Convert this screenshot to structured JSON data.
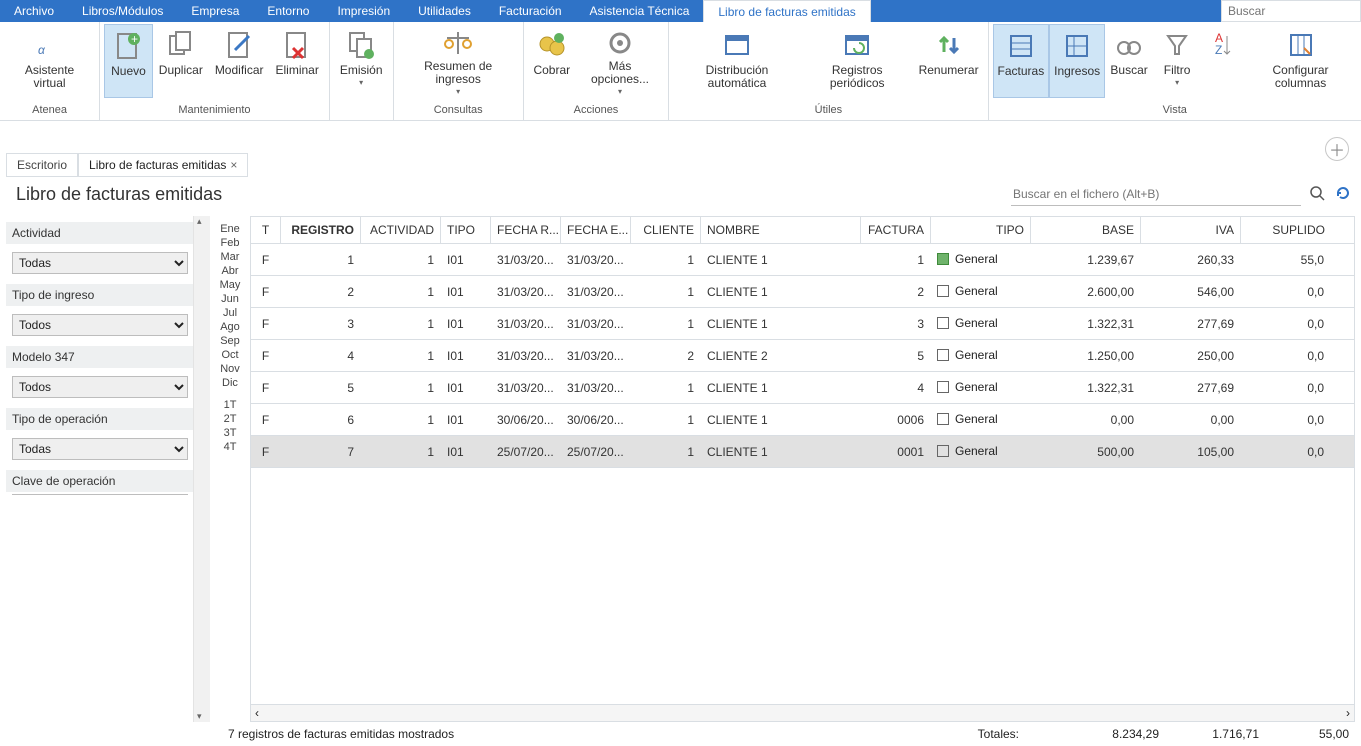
{
  "menu": {
    "items": [
      "Archivo",
      "Libros/Módulos",
      "Empresa",
      "Entorno",
      "Impresión",
      "Utilidades",
      "Facturación",
      "Asistencia Técnica"
    ],
    "active": "Libro de facturas emitidas",
    "search_placeholder": "Buscar"
  },
  "ribbon": {
    "groups": [
      {
        "label": "Atenea",
        "buttons": [
          {
            "name": "asistente",
            "lbl": "Asistente virtual",
            "dd": false
          }
        ]
      },
      {
        "label": "Mantenimiento",
        "buttons": [
          {
            "name": "nuevo",
            "lbl": "Nuevo",
            "active": true
          },
          {
            "name": "duplicar",
            "lbl": "Duplicar"
          },
          {
            "name": "modificar",
            "lbl": "Modificar"
          },
          {
            "name": "eliminar",
            "lbl": "Eliminar"
          }
        ]
      },
      {
        "label": "",
        "buttons": [
          {
            "name": "emision",
            "lbl": "Emisión",
            "dd": true
          }
        ]
      },
      {
        "label": "Consultas",
        "buttons": [
          {
            "name": "resumen",
            "lbl": "Resumen de ingresos",
            "dd": true
          }
        ]
      },
      {
        "label": "Acciones",
        "buttons": [
          {
            "name": "cobrar",
            "lbl": "Cobrar"
          },
          {
            "name": "mas",
            "lbl": "Más opciones...",
            "dd": true
          }
        ]
      },
      {
        "label": "Útiles",
        "buttons": [
          {
            "name": "dist",
            "lbl": "Distribución automática"
          },
          {
            "name": "regper",
            "lbl": "Registros periódicos"
          },
          {
            "name": "renum",
            "lbl": "Renumerar"
          }
        ]
      },
      {
        "label": "Vista",
        "buttons": [
          {
            "name": "facturas",
            "lbl": "Facturas",
            "active": true
          },
          {
            "name": "ingresos",
            "lbl": "Ingresos",
            "active": true
          },
          {
            "name": "buscar",
            "lbl": "Buscar"
          },
          {
            "name": "filtro",
            "lbl": "Filtro",
            "dd": true
          },
          {
            "name": "orden",
            "lbl": ""
          },
          {
            "name": "cols",
            "lbl": "Configurar columnas"
          }
        ]
      }
    ]
  },
  "tabs": {
    "t1": "Escritorio",
    "t2": "Libro de facturas emitidas"
  },
  "view": {
    "title": "Libro de facturas emitidas",
    "search_placeholder": "Buscar en el fichero (Alt+B)"
  },
  "filters": {
    "f1": {
      "label": "Actividad",
      "value": "Todas"
    },
    "f2": {
      "label": "Tipo de ingreso",
      "value": "Todos"
    },
    "f3": {
      "label": "Modelo 347",
      "value": "Todos"
    },
    "f4": {
      "label": "Tipo de operación",
      "value": "Todas"
    },
    "f5": {
      "label": "Clave de operación",
      "value": ""
    }
  },
  "months": [
    "Ene",
    "Feb",
    "Mar",
    "Abr",
    "May",
    "Jun",
    "Jul",
    "Ago",
    "Sep",
    "Oct",
    "Nov",
    "Dic",
    "",
    "1T",
    "2T",
    "3T",
    "4T"
  ],
  "columns": {
    "t": "T",
    "reg": "REGISTRO",
    "act": "ACTIVIDAD",
    "tipo": "TIPO",
    "fr": "FECHA R...",
    "fe": "FECHA E...",
    "cli": "CLIENTE",
    "nom": "NOMBRE",
    "fac": "FACTURA",
    "tipo2": "TIPO",
    "base": "BASE",
    "iva": "IVA",
    "sup": "SUPLIDO"
  },
  "rows": [
    {
      "t": "F",
      "reg": "1",
      "act": "1",
      "tipo": "I01",
      "fr": "31/03/20...",
      "fe": "31/03/20...",
      "cli": "1",
      "nom": "CLIENTE 1",
      "fac": "1",
      "tipo2": "General",
      "tipo2_color": "green",
      "base": "1.239,67",
      "iva": "260,33",
      "sup": "55,0"
    },
    {
      "t": "F",
      "reg": "2",
      "act": "1",
      "tipo": "I01",
      "fr": "31/03/20...",
      "fe": "31/03/20...",
      "cli": "1",
      "nom": "CLIENTE 1",
      "fac": "2",
      "tipo2": "General",
      "base": "2.600,00",
      "iva": "546,00",
      "sup": "0,0"
    },
    {
      "t": "F",
      "reg": "3",
      "act": "1",
      "tipo": "I01",
      "fr": "31/03/20...",
      "fe": "31/03/20...",
      "cli": "1",
      "nom": "CLIENTE 1",
      "fac": "3",
      "tipo2": "General",
      "base": "1.322,31",
      "iva": "277,69",
      "sup": "0,0"
    },
    {
      "t": "F",
      "reg": "4",
      "act": "1",
      "tipo": "I01",
      "fr": "31/03/20...",
      "fe": "31/03/20...",
      "cli": "2",
      "nom": "CLIENTE 2",
      "fac": "5",
      "tipo2": "General",
      "base": "1.250,00",
      "iva": "250,00",
      "sup": "0,0"
    },
    {
      "t": "F",
      "reg": "5",
      "act": "1",
      "tipo": "I01",
      "fr": "31/03/20...",
      "fe": "31/03/20...",
      "cli": "1",
      "nom": "CLIENTE 1",
      "fac": "4",
      "tipo2": "General",
      "base": "1.322,31",
      "iva": "277,69",
      "sup": "0,0"
    },
    {
      "t": "F",
      "reg": "6",
      "act": "1",
      "tipo": "I01",
      "fr": "30/06/20...",
      "fe": "30/06/20...",
      "cli": "1",
      "nom": "CLIENTE 1",
      "fac": "0006",
      "tipo2": "General",
      "base": "0,00",
      "iva": "0,00",
      "sup": "0,0"
    },
    {
      "t": "F",
      "reg": "7",
      "act": "1",
      "tipo": "I01",
      "fr": "25/07/20...",
      "fe": "25/07/20...",
      "cli": "1",
      "nom": "CLIENTE 1",
      "fac": "0001",
      "tipo2": "General",
      "base": "500,00",
      "iva": "105,00",
      "sup": "0,0",
      "sel": true
    }
  ],
  "status": {
    "count": "7 registros de facturas emitidas mostrados",
    "totals_label": "Totales:",
    "base": "8.234,29",
    "iva": "1.716,71",
    "sup": "55,00"
  }
}
